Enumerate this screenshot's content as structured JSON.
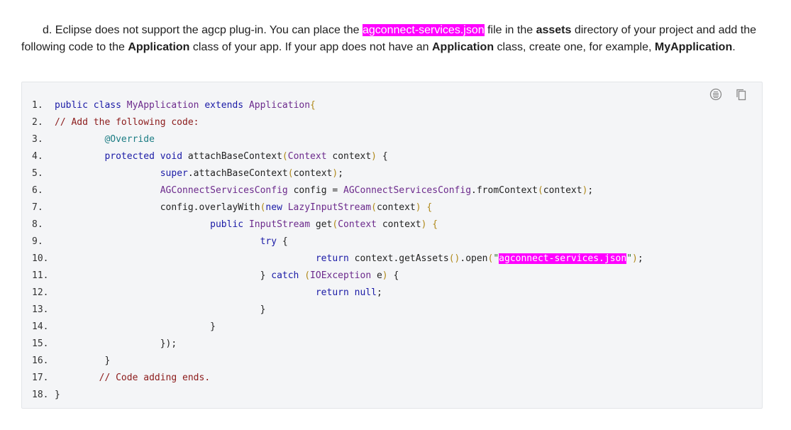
{
  "paragraph": {
    "p1": "d. Eclipse does not support the agcp plug-in. You can place the ",
    "file": "agconnect-services.json",
    "p2": " file in the ",
    "assets": "assets",
    "p3": " directory of your project and add the following code to the ",
    "app1": "Application",
    "p4": " class of your app. If your app does not have an ",
    "app2": "Application",
    "p5": " class, create one, for example, ",
    "myapp": "MyApplication",
    "p6": "."
  },
  "code_icons": {
    "format": "format-icon",
    "copy": "copy-icon"
  },
  "code_lines": [
    {
      "n": "1.",
      "t": [
        [
          "kw",
          "public class "
        ],
        [
          "ty",
          "MyApplication "
        ],
        [
          "kw",
          "extends "
        ],
        [
          "ty",
          "Application"
        ],
        [
          "br",
          "{"
        ]
      ]
    },
    {
      "n": "2.",
      "t": [
        [
          "cm",
          "// Add the following code:"
        ]
      ]
    },
    {
      "n": "3.",
      "t": [
        [
          "",
          "         "
        ],
        [
          "an",
          "@Override"
        ]
      ]
    },
    {
      "n": "4.",
      "t": [
        [
          "",
          "         "
        ],
        [
          "kw",
          "protected void "
        ],
        [
          "",
          "attachBaseContext"
        ],
        [
          "br",
          "("
        ],
        [
          "ty",
          "Context "
        ],
        [
          "",
          "context"
        ],
        [
          "br",
          ")"
        ],
        [
          "",
          " {"
        ]
      ]
    },
    {
      "n": "5.",
      "t": [
        [
          "",
          "                   "
        ],
        [
          "kw",
          "super"
        ],
        [
          "",
          ".attachBaseContext"
        ],
        [
          "br",
          "("
        ],
        [
          "",
          "context"
        ],
        [
          "br",
          ")"
        ],
        [
          "",
          ";"
        ]
      ]
    },
    {
      "n": "6.",
      "t": [
        [
          "",
          "                   "
        ],
        [
          "ty",
          "AGConnectServicesConfig "
        ],
        [
          "",
          "config = "
        ],
        [
          "ty",
          "AGConnectServicesConfig"
        ],
        [
          "",
          ".fromContext"
        ],
        [
          "br",
          "("
        ],
        [
          "",
          "context"
        ],
        [
          "br",
          ")"
        ],
        [
          "",
          ";"
        ]
      ]
    },
    {
      "n": "7.",
      "t": [
        [
          "",
          "                   config.overlayWith"
        ],
        [
          "br",
          "("
        ],
        [
          "kw",
          "new "
        ],
        [
          "ty",
          "LazyInputStream"
        ],
        [
          "br",
          "("
        ],
        [
          "",
          "context"
        ],
        [
          "br",
          ")"
        ],
        [
          "",
          " "
        ],
        [
          "br",
          "{"
        ]
      ]
    },
    {
      "n": "8.",
      "t": [
        [
          "",
          "                            "
        ],
        [
          "kw",
          "public "
        ],
        [
          "ty",
          "InputStream "
        ],
        [
          "",
          "get"
        ],
        [
          "br",
          "("
        ],
        [
          "ty",
          "Context "
        ],
        [
          "",
          "context"
        ],
        [
          "br",
          ")"
        ],
        [
          "",
          " "
        ],
        [
          "br",
          "{"
        ]
      ]
    },
    {
      "n": "9.",
      "t": [
        [
          "",
          "                                     "
        ],
        [
          "kw",
          "try "
        ],
        [
          "",
          "{"
        ]
      ]
    },
    {
      "n": "10.",
      "t": [
        [
          "",
          "                                               "
        ],
        [
          "kw",
          "return "
        ],
        [
          "",
          "context.getAssets"
        ],
        [
          "br",
          "()"
        ],
        [
          "",
          ".open"
        ],
        [
          "br",
          "("
        ],
        [
          "st",
          "\""
        ],
        [
          "hl",
          "agconnect-services.json"
        ],
        [
          "st",
          "\""
        ],
        [
          "br",
          ")"
        ],
        [
          "",
          ";"
        ]
      ]
    },
    {
      "n": "11.",
      "t": [
        [
          "",
          "                                     } "
        ],
        [
          "kw",
          "catch "
        ],
        [
          "br",
          "("
        ],
        [
          "ty",
          "IOException "
        ],
        [
          "",
          "e"
        ],
        [
          "br",
          ")"
        ],
        [
          "",
          " {"
        ]
      ]
    },
    {
      "n": "12.",
      "t": [
        [
          "",
          "                                               "
        ],
        [
          "kw",
          "return null"
        ],
        [
          "",
          ";"
        ]
      ]
    },
    {
      "n": "13.",
      "t": [
        [
          "",
          "                                     }"
        ]
      ]
    },
    {
      "n": "14.",
      "t": [
        [
          "",
          "                            }"
        ]
      ]
    },
    {
      "n": "15.",
      "t": [
        [
          "",
          "                   });"
        ]
      ]
    },
    {
      "n": "16.",
      "t": [
        [
          "",
          "         }"
        ]
      ]
    },
    {
      "n": "17.",
      "t": [
        [
          "",
          "        "
        ],
        [
          "cm",
          "// Code adding ends."
        ]
      ]
    },
    {
      "n": "18.",
      "t": [
        [
          "",
          "}"
        ]
      ]
    }
  ]
}
